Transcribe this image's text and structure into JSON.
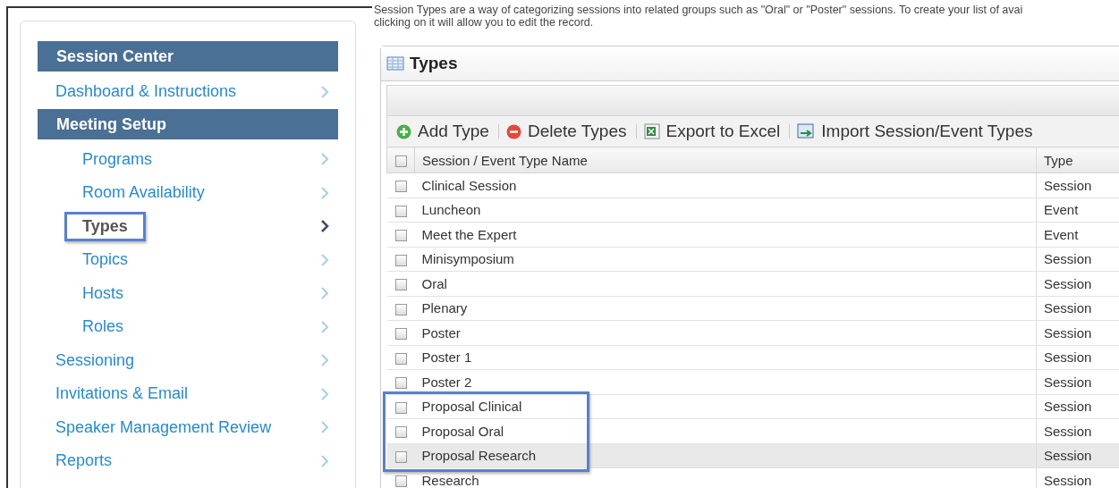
{
  "intro": {
    "lines": [
      "Session Types are a way of categorizing sessions into related groups such as \"Oral\" or \"Poster\" sessions. To create your list of avai",
      "clicking on it will allow you to edit the record."
    ]
  },
  "sidebar": {
    "sections": [
      {
        "kind": "header",
        "label": "Session Center"
      },
      {
        "kind": "link",
        "label": "Dashboard & Instructions",
        "selected": false,
        "highlighted": false
      },
      {
        "kind": "header",
        "label": "Meeting Setup"
      },
      {
        "kind": "group",
        "children": [
          {
            "label": "Programs",
            "selected": false,
            "highlighted": false
          },
          {
            "label": "Room Availability",
            "selected": false,
            "highlighted": false
          },
          {
            "label": "Types",
            "selected": true,
            "highlighted": true
          },
          {
            "label": "Topics",
            "selected": false,
            "highlighted": false
          },
          {
            "label": "Hosts",
            "selected": false,
            "highlighted": false
          },
          {
            "label": "Roles",
            "selected": false,
            "highlighted": false
          }
        ]
      },
      {
        "kind": "link",
        "label": "Sessioning",
        "selected": false,
        "highlighted": false
      },
      {
        "kind": "link",
        "label": "Invitations & Email",
        "selected": false,
        "highlighted": false
      },
      {
        "kind": "link",
        "label": "Speaker Management Review",
        "selected": false,
        "highlighted": false
      },
      {
        "kind": "link",
        "label": "Reports",
        "selected": false,
        "highlighted": false
      }
    ]
  },
  "panel": {
    "title": "Types",
    "toolbar": [
      {
        "kind": "add",
        "label": "Add Type"
      },
      {
        "kind": "delete",
        "label": "Delete Types"
      },
      {
        "kind": "excel",
        "label": "Export to Excel"
      },
      {
        "kind": "import",
        "label": "Import Session/Event Types"
      }
    ],
    "table": {
      "columns": [
        "Session / Event Type Name",
        "Type"
      ],
      "header_checked": false,
      "rows": [
        {
          "name": "Clinical Session",
          "type": "Session",
          "checked": false,
          "selected": false,
          "highlighted": false
        },
        {
          "name": "Luncheon",
          "type": "Event",
          "checked": false,
          "selected": false,
          "highlighted": false
        },
        {
          "name": "Meet the Expert",
          "type": "Event",
          "checked": false,
          "selected": false,
          "highlighted": false
        },
        {
          "name": "Minisymposium",
          "type": "Session",
          "checked": false,
          "selected": false,
          "highlighted": false
        },
        {
          "name": "Oral",
          "type": "Session",
          "checked": false,
          "selected": false,
          "highlighted": false
        },
        {
          "name": "Plenary",
          "type": "Session",
          "checked": false,
          "selected": false,
          "highlighted": false
        },
        {
          "name": "Poster",
          "type": "Session",
          "checked": false,
          "selected": false,
          "highlighted": false
        },
        {
          "name": "Poster 1",
          "type": "Session",
          "checked": false,
          "selected": false,
          "highlighted": false
        },
        {
          "name": "Poster 2",
          "type": "Session",
          "checked": false,
          "selected": false,
          "highlighted": false
        },
        {
          "name": "Proposal Clinical",
          "type": "Session",
          "checked": false,
          "selected": false,
          "highlighted": true
        },
        {
          "name": "Proposal Oral",
          "type": "Session",
          "checked": false,
          "selected": false,
          "highlighted": true
        },
        {
          "name": "Proposal Research",
          "type": "Session",
          "checked": false,
          "selected": true,
          "highlighted": true
        },
        {
          "name": "Research",
          "type": "Session",
          "checked": false,
          "selected": false,
          "highlighted": false
        }
      ]
    }
  }
}
